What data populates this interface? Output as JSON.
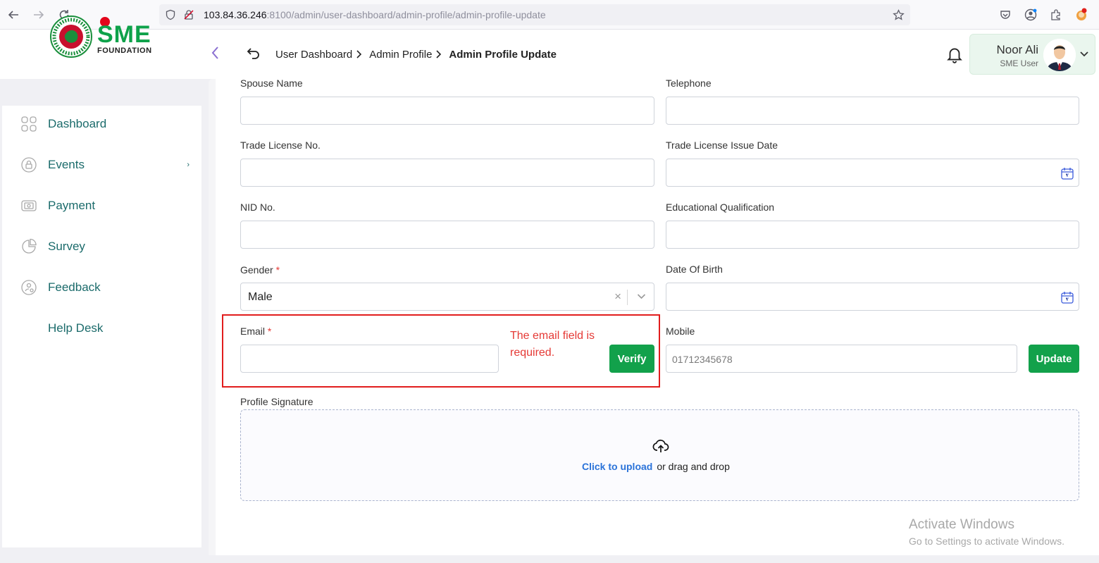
{
  "browser": {
    "url_host": "103.84.36.246",
    "url_rest": ":8100/admin/user-dashboard/admin-profile/admin-profile-update"
  },
  "header": {
    "logo_text": "SME",
    "logo_subtext": "FOUNDATION",
    "breadcrumb": [
      {
        "label": "User Dashboard"
      },
      {
        "label": "Admin Profile"
      },
      {
        "label": "Admin Profile Update"
      }
    ],
    "user": {
      "name": "Noor Ali",
      "role": "SME User"
    }
  },
  "sidebar": {
    "items": [
      {
        "label": "Dashboard",
        "icon": "grid-icon"
      },
      {
        "label": "Events",
        "icon": "lock-icon"
      },
      {
        "label": "Payment",
        "icon": "cash-icon"
      },
      {
        "label": "Survey",
        "icon": "pie-chart-icon"
      },
      {
        "label": "Feedback",
        "icon": "feedback-icon"
      },
      {
        "label": "Help Desk",
        "icon": ""
      }
    ],
    "events_arrow": "›"
  },
  "form": {
    "spouse_name": {
      "label": "Spouse Name",
      "value": ""
    },
    "telephone": {
      "label": "Telephone",
      "value": ""
    },
    "trade_license_no": {
      "label": "Trade License No.",
      "value": ""
    },
    "trade_license_issue_date": {
      "label": "Trade License Issue Date",
      "value": ""
    },
    "nid_no": {
      "label": "NID No.",
      "value": ""
    },
    "educational_qualification": {
      "label": "Educational Qualification",
      "value": ""
    },
    "gender": {
      "label": "Gender",
      "required_mark": "*",
      "value": "Male",
      "clear": "×"
    },
    "date_of_birth": {
      "label": "Date Of Birth",
      "value": ""
    },
    "email": {
      "label": "Email",
      "required_mark": "*",
      "value": "",
      "error": "The email field is required.",
      "verify_label": "Verify"
    },
    "mobile": {
      "label": "Mobile",
      "placeholder": "01712345678",
      "update_label": "Update"
    },
    "profile_signature": {
      "label": "Profile Signature",
      "upload_link": "Click to upload",
      "upload_text": "or drag and drop"
    }
  },
  "watermark": {
    "line1": "Activate Windows",
    "line2": "Go to Settings to activate Windows."
  },
  "colors": {
    "accent_green": "#12a14b",
    "error_red": "#e53935",
    "sidebar_text": "#1b6b6b",
    "link_blue": "#2b73d9"
  }
}
